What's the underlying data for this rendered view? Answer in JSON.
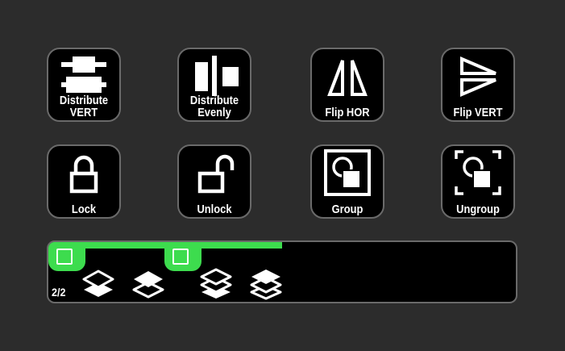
{
  "buttons": {
    "distribute_vert": {
      "label": "Distribute\nVERT",
      "icon": "distribute-vertical-icon"
    },
    "distribute_evenly": {
      "label": "Distribute\nEvenly",
      "icon": "distribute-evenly-icon"
    },
    "flip_hor": {
      "label": "Flip HOR",
      "icon": "flip-horizontal-icon"
    },
    "flip_vert": {
      "label": "Flip VERT",
      "icon": "flip-vertical-icon"
    },
    "lock": {
      "label": "Lock",
      "icon": "lock-icon"
    },
    "unlock": {
      "label": "Unlock",
      "icon": "unlock-icon"
    },
    "group": {
      "label": "Group",
      "icon": "group-icon"
    },
    "ungroup": {
      "label": "Ungroup",
      "icon": "ungroup-icon"
    }
  },
  "page_strip": {
    "counter": "2/2",
    "progress": 0.5,
    "layer_icons": [
      "layer-down-icon",
      "layer-up-icon",
      "layer-to-back-icon",
      "layer-to-front-icon"
    ]
  },
  "colors": {
    "background": "#2c2c2c",
    "button_bg": "#000000",
    "button_border": "#6a6a6a",
    "accent": "#3ddc4e",
    "foreground": "#ffffff"
  }
}
